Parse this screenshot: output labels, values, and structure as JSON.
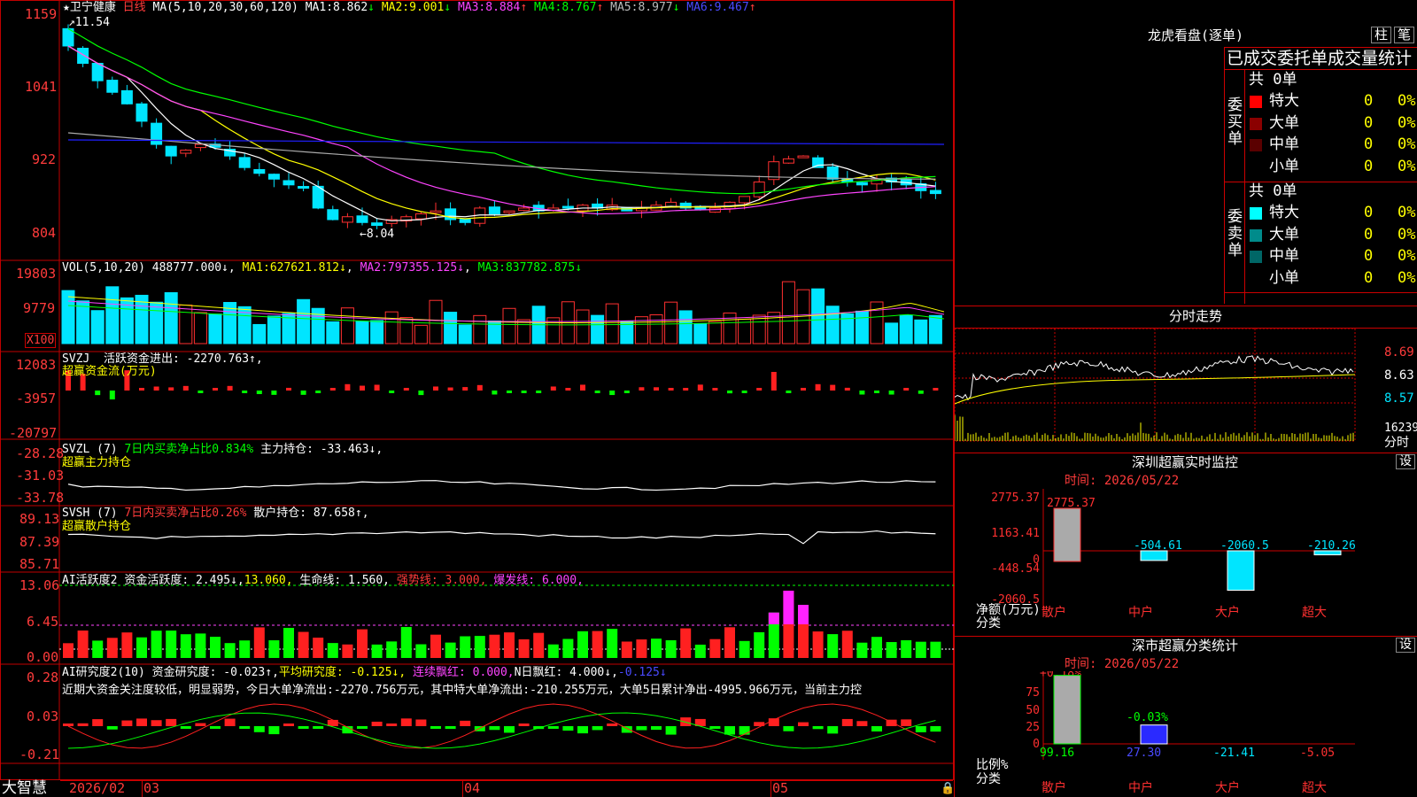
{
  "colors": {
    "up": "#ff3030",
    "down": "#00e5ff",
    "grid": "#c00000",
    "ma1": "#ffffff",
    "ma2": "#ffff00",
    "ma3": "#ff44ff",
    "ma4": "#00ff00",
    "ma5": "#aaaaaa",
    "ma6": "#2020ff"
  },
  "stock": {
    "name": "卫宁健康",
    "period": "日线",
    "ma_label": "MA(5,10,20,30,60,120)",
    "ma": [
      {
        "label": "MA1:",
        "value": "8.862",
        "arrow": "↓"
      },
      {
        "label": "MA2:",
        "value": "9.001",
        "arrow": "↓"
      },
      {
        "label": "MA3:",
        "value": "8.884",
        "arrow": "↑"
      },
      {
        "label": "MA4:",
        "value": "8.767",
        "arrow": "↑"
      },
      {
        "label": "MA5:",
        "value": "8.977",
        "arrow": "↓"
      },
      {
        "label": "MA6:",
        "value": "9.467",
        "arrow": "↑"
      }
    ],
    "high_label": "11.54",
    "low_label": "8.04",
    "price_ticks": [
      "1159",
      "1041",
      "922",
      "804"
    ]
  },
  "vol": {
    "label": "VOL(5,10,20)",
    "value": "488777.000↓",
    "ma": [
      {
        "label": "MA1:",
        "value": "627621.812↓"
      },
      {
        "label": "MA2:",
        "value": "797355.125↓"
      },
      {
        "label": "MA3:",
        "value": "837782.875↓"
      }
    ],
    "ticks": [
      "19803",
      "9779"
    ],
    "unit": "X100"
  },
  "svzj": {
    "label": "SVZJ",
    "text": "活跃资金进出: -2270.763↑,",
    "sub": "超赢资金流(万元)",
    "ticks": [
      "12083",
      "-3957",
      "-20797"
    ]
  },
  "svzl": {
    "label": "SVZL (7)",
    "text1": "7日内买卖净占比0.834%",
    "text2": "主力持仓: -33.463↓,",
    "sub": "超赢主力持仓",
    "ticks": [
      "-28.28",
      "-31.03",
      "-33.78"
    ]
  },
  "svsh": {
    "label": "SVSH (7)",
    "text1": "7日内买卖净占比0.26%",
    "text2": "散户持仓: 87.658↑,",
    "sub": "超赢散户持仓",
    "ticks": [
      "89.13",
      "87.39",
      "85.71"
    ]
  },
  "ai1": {
    "label": "AI活跃度2",
    "parts": [
      {
        "text": "资金活跃度: 2.495↓,",
        "c": "white"
      },
      {
        "text": "13.060,",
        "c": "yellow"
      },
      {
        "text": "生命线: 1.560,",
        "c": "white"
      },
      {
        "text": "强势线: 3.000,",
        "c": "red"
      },
      {
        "text": "爆发线: 6.000,",
        "c": "mag"
      }
    ],
    "ticks": [
      "13.06",
      "6.45",
      "0.00"
    ]
  },
  "ai2": {
    "label": "AI研究度2(10)",
    "parts": [
      {
        "text": "资金研究度: -0.023↑,",
        "c": "white"
      },
      {
        "text": "平均研究度: -0.125↓,",
        "c": "yellow"
      },
      {
        "text": "连续飘红: 0.000,",
        "c": "mag"
      },
      {
        "text": "N日飘红: 4.000↓,",
        "c": "white"
      },
      {
        "text": "-0.125↓",
        "c": "blue"
      }
    ],
    "comment": "近期大资金关注度较低，明显弱势，今日大单净流出:-2270.756万元，其中特大单净流出:-210.255万元，大单5日累计净出-4995.966万元，当前主力控",
    "ticks": [
      "0.28",
      "0.03",
      "-0.21"
    ]
  },
  "dates": [
    "2026/02",
    "03",
    "04",
    "05"
  ],
  "footer": "大智慧",
  "dragon": {
    "title": "龙虎看盘(逐单)",
    "tab1": "柱",
    "tab2": "笔",
    "header": "已成交委托单成交量统计",
    "buy": {
      "side": "委买单",
      "total": "共 0单",
      "rows": [
        {
          "label": "特大",
          "count": "0",
          "pct": "0%",
          "color": "#ff0000"
        },
        {
          "label": "大单",
          "count": "0",
          "pct": "0%",
          "color": "#8b0000"
        },
        {
          "label": "中单",
          "count": "0",
          "pct": "0%",
          "color": "#5a0000"
        },
        {
          "label": "小单",
          "count": "0",
          "pct": "0%",
          "color": "#000000"
        }
      ]
    },
    "sell": {
      "side": "委卖单",
      "total": "共 0单",
      "rows": [
        {
          "label": "特大",
          "count": "0",
          "pct": "0%",
          "color": "#00ffff"
        },
        {
          "label": "大单",
          "count": "0",
          "pct": "0%",
          "color": "#008b8b"
        },
        {
          "label": "中单",
          "count": "0",
          "pct": "0%",
          "color": "#006666"
        },
        {
          "label": "小单",
          "count": "0",
          "pct": "0%",
          "color": "#000000"
        }
      ]
    }
  },
  "intraday": {
    "title": "分时走势",
    "ticks": [
      "8.69",
      "8.63",
      "8.57"
    ],
    "vol_tick": "16239",
    "vol_label": "分时"
  },
  "monitor": {
    "title": "深圳超赢实时监控",
    "set": "设",
    "time": "时间: 2026/05/22",
    "ticks": [
      "2775.37",
      "1163.41",
      "0",
      "-448.54",
      "-2060.5"
    ],
    "axis_label": "净额(万元)",
    "cat_label": "分类",
    "bars": [
      {
        "cat": "散户",
        "value": 2775.37,
        "label": "2775.37"
      },
      {
        "cat": "中户",
        "value": -504.61,
        "label": "-504.61"
      },
      {
        "cat": "大户",
        "value": -2060.5,
        "label": "-2060.5"
      },
      {
        "cat": "超大",
        "value": -210.26,
        "label": "-210.26"
      }
    ]
  },
  "classify": {
    "title": "深市超赢分类统计",
    "set": "设",
    "time": "时间: 2026/05/22",
    "ticks": [
      "75",
      "50",
      "25",
      "0"
    ],
    "axis_label": "比例%",
    "cat_label": "分类",
    "top_labels": [
      "+0.18%",
      "-0.03%"
    ],
    "bars": [
      {
        "cat": "散户",
        "value": 99.16,
        "label": "99.16"
      },
      {
        "cat": "中户",
        "value": 27.3,
        "label": "27.30"
      },
      {
        "cat": "大户",
        "value": -21.41,
        "label": "-21.41"
      },
      {
        "cat": "超大",
        "value": -5.05,
        "label": "-5.05"
      }
    ]
  }
}
